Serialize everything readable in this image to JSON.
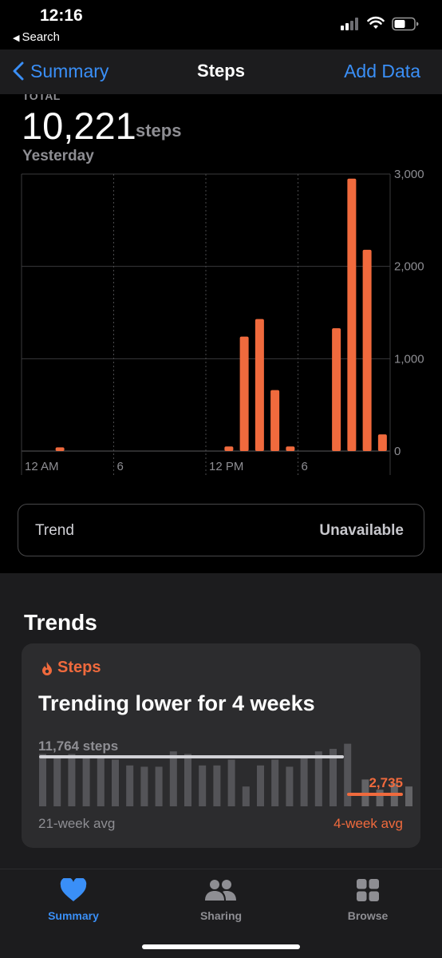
{
  "status_bar": {
    "time": "12:16",
    "back_label": "Search"
  },
  "navbar": {
    "back_label": "Summary",
    "title": "Steps",
    "action_label": "Add Data"
  },
  "total": {
    "label": "TOTAL",
    "value": "10,221",
    "unit": "steps",
    "date": "Yesterday"
  },
  "chart_data": {
    "type": "bar",
    "x_tick_labels": [
      "12 AM",
      "6",
      "12 PM",
      "6"
    ],
    "y_tick_labels": [
      "3,000",
      "2,000",
      "1,000",
      "0"
    ],
    "ylim": [
      0,
      3000
    ],
    "grid": true,
    "series": [
      {
        "hours": [
          2,
          13,
          14,
          15,
          16,
          17,
          20,
          21,
          22,
          23
        ],
        "values": [
          40,
          50,
          1240,
          1430,
          660,
          50,
          1330,
          2950,
          2180,
          180
        ]
      }
    ]
  },
  "trend_row": {
    "label": "Trend",
    "value": "Unavailable"
  },
  "trends": {
    "title": "Trends",
    "card": {
      "metric": "Steps",
      "headline": "Trending lower for 4 weeks",
      "long_avg_value": "11,764 steps",
      "long_avg_label": "21-week avg",
      "short_avg_value": "2,735",
      "short_avg_label": "4-week avg",
      "weekly_levels": [
        0.82,
        0.8,
        0.82,
        0.76,
        0.76,
        0.73,
        0.64,
        0.62,
        0.62,
        0.86,
        0.82,
        0.64,
        0.64,
        0.73,
        0.31,
        0.64,
        0.73,
        0.62,
        0.76,
        0.86,
        0.9,
        0.98
      ],
      "recent_levels": [
        0.42,
        0.26,
        0.36,
        0.31
      ]
    }
  },
  "tabbar": {
    "items": [
      {
        "label": "Summary",
        "active": true
      },
      {
        "label": "Sharing",
        "active": false
      },
      {
        "label": "Browse",
        "active": false
      }
    ]
  },
  "colors": {
    "accent": "#3a8ff7",
    "bar": "#f06a3d",
    "label_gray": "#8e8e93"
  }
}
